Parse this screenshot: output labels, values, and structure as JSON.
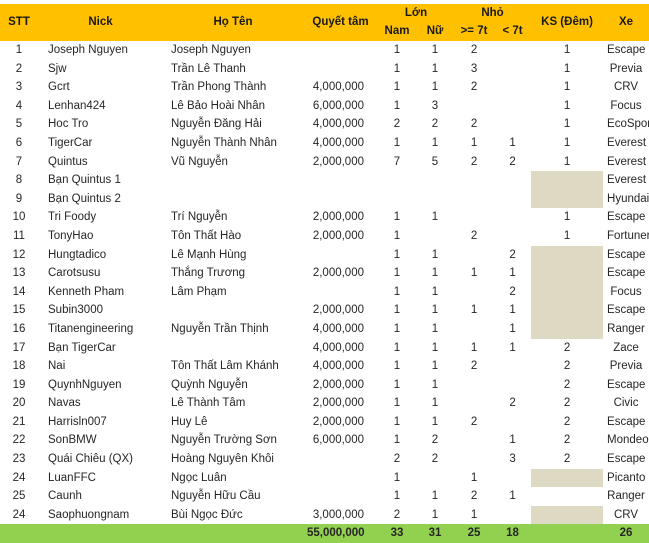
{
  "table": {
    "headers": {
      "stt": "STT",
      "nick": "Nick",
      "hoten": "Họ Tên",
      "quyettam": "Quyết tâm",
      "lon": "Lớn",
      "nho": "Nhỏ",
      "nam": "Nam",
      "nu": "Nữ",
      "ge7t": ">= 7t",
      "lt7t": "< 7t",
      "ks": "KS (Đêm)",
      "xe": "Xe"
    },
    "colors": {
      "header_bg": "#FFC000",
      "total_bg": "#92D050",
      "shaded_cell_bg": "#DDD9C3",
      "text": "#262626"
    },
    "rows": [
      {
        "stt": "1",
        "nick": "Joseph Nguyen",
        "hoten": "Joseph Nguyen",
        "quyettam": "",
        "nam": "1",
        "nu": "1",
        "ge7t": "2",
        "lt7t": "",
        "ks": "1",
        "ks_shaded": false,
        "xe": "Escape"
      },
      {
        "stt": "2",
        "nick": "Sjw",
        "hoten": "Trần Lê Thanh",
        "quyettam": "",
        "nam": "1",
        "nu": "1",
        "ge7t": "3",
        "lt7t": "",
        "ks": "1",
        "ks_shaded": false,
        "xe": "Previa"
      },
      {
        "stt": "3",
        "nick": "Gcrt",
        "hoten": "Trần Phong Thành",
        "quyettam": "4,000,000",
        "nam": "1",
        "nu": "1",
        "ge7t": "2",
        "lt7t": "",
        "ks": "1",
        "ks_shaded": false,
        "xe": "CRV"
      },
      {
        "stt": "4",
        "nick": "Lenhan424",
        "hoten": "Lê Bảo Hoài Nhân",
        "quyettam": "6,000,000",
        "nam": "1",
        "nu": "3",
        "ge7t": "",
        "lt7t": "",
        "ks": "1",
        "ks_shaded": false,
        "xe": "Focus"
      },
      {
        "stt": "5",
        "nick": "Hoc Tro",
        "hoten": "Nguyễn Đăng Hải",
        "quyettam": "4,000,000",
        "nam": "2",
        "nu": "2",
        "ge7t": "2",
        "lt7t": "",
        "ks": "1",
        "ks_shaded": false,
        "xe": "EcoSport"
      },
      {
        "stt": "6",
        "nick": "TigerCar",
        "hoten": "Nguyễn Thành Nhân",
        "quyettam": "4,000,000",
        "nam": "1",
        "nu": "1",
        "ge7t": "1",
        "lt7t": "1",
        "ks": "1",
        "ks_shaded": false,
        "xe": "Everest"
      },
      {
        "stt": "7",
        "nick": "Quintus",
        "hoten": "Vũ Nguyễn",
        "quyettam": "2,000,000",
        "nam": "7",
        "nu": "5",
        "ge7t": "2",
        "lt7t": "2",
        "ks": "1",
        "ks_shaded": false,
        "xe": "Everest"
      },
      {
        "stt": "8",
        "nick": "Bạn Quintus 1",
        "hoten": "",
        "quyettam": "",
        "nam": "",
        "nu": "",
        "ge7t": "",
        "lt7t": "",
        "ks": "",
        "ks_shaded": true,
        "xe": "Everest"
      },
      {
        "stt": "9",
        "nick": "Bạn Quintus 2",
        "hoten": "",
        "quyettam": "",
        "nam": "",
        "nu": "",
        "ge7t": "",
        "lt7t": "",
        "ks": "",
        "ks_shaded": true,
        "xe": "Hyundai"
      },
      {
        "stt": "10",
        "nick": "Tri Foody",
        "hoten": "Trí Nguyễn",
        "quyettam": "2,000,000",
        "nam": "1",
        "nu": "1",
        "ge7t": "",
        "lt7t": "",
        "ks": "1",
        "ks_shaded": false,
        "xe": "Escape"
      },
      {
        "stt": "11",
        "nick": "TonyHao",
        "hoten": "Tôn Thất Hào",
        "quyettam": "2,000,000",
        "nam": "1",
        "nu": "",
        "ge7t": "2",
        "lt7t": "",
        "ks": "1",
        "ks_shaded": false,
        "xe": "Fortuner"
      },
      {
        "stt": "12",
        "nick": "Hungtadico",
        "hoten": "Lê Mạnh Hùng",
        "quyettam": "",
        "nam": "1",
        "nu": "1",
        "ge7t": "",
        "lt7t": "2",
        "ks": "",
        "ks_shaded": true,
        "xe": "Escape"
      },
      {
        "stt": "13",
        "nick": "Carotsusu",
        "hoten": "Thắng Trương",
        "quyettam": "2,000,000",
        "nam": "1",
        "nu": "1",
        "ge7t": "1",
        "lt7t": "1",
        "ks": "",
        "ks_shaded": true,
        "xe": "Escape"
      },
      {
        "stt": "14",
        "nick": "Kenneth Pham",
        "hoten": "Lâm Phạm",
        "quyettam": "",
        "nam": "1",
        "nu": "1",
        "ge7t": "",
        "lt7t": "2",
        "ks": "",
        "ks_shaded": true,
        "xe": "Focus"
      },
      {
        "stt": "15",
        "nick": "Subin3000",
        "hoten": "",
        "quyettam": "2,000,000",
        "nam": "1",
        "nu": "1",
        "ge7t": "1",
        "lt7t": "1",
        "ks": "",
        "ks_shaded": true,
        "xe": "Escape"
      },
      {
        "stt": "16",
        "nick": "Titanengineering",
        "hoten": "Nguyễn Trần Thịnh",
        "quyettam": "4,000,000",
        "nam": "1",
        "nu": "1",
        "ge7t": "",
        "lt7t": "1",
        "ks": "",
        "ks_shaded": true,
        "xe": "Ranger"
      },
      {
        "stt": "17",
        "nick": "Bạn TigerCar",
        "hoten": "",
        "quyettam": "4,000,000",
        "nam": "1",
        "nu": "1",
        "ge7t": "1",
        "lt7t": "1",
        "ks": "2",
        "ks_shaded": false,
        "xe": "Zace"
      },
      {
        "stt": "18",
        "nick": "Nai",
        "hoten": "Tôn Thất Lâm Khánh",
        "quyettam": "4,000,000",
        "nam": "1",
        "nu": "1",
        "ge7t": "2",
        "lt7t": "",
        "ks": "2",
        "ks_shaded": false,
        "xe": "Previa"
      },
      {
        "stt": "19",
        "nick": "QuynhNguyen",
        "hoten": "Quỳnh Nguyễn",
        "quyettam": "2,000,000",
        "nam": "1",
        "nu": "1",
        "ge7t": "",
        "lt7t": "",
        "ks": "2",
        "ks_shaded": false,
        "xe": "Escape"
      },
      {
        "stt": "20",
        "nick": "Navas",
        "hoten": "Lê Thành Tâm",
        "quyettam": "2,000,000",
        "nam": "1",
        "nu": "1",
        "ge7t": "",
        "lt7t": "2",
        "ks": "2",
        "ks_shaded": false,
        "xe": "Civic"
      },
      {
        "stt": "21",
        "nick": "Harrisln007",
        "hoten": "Huy Lê",
        "quyettam": "2,000,000",
        "nam": "1",
        "nu": "1",
        "ge7t": "2",
        "lt7t": "",
        "ks": "2",
        "ks_shaded": false,
        "xe": "Escape"
      },
      {
        "stt": "22",
        "nick": "SonBMW",
        "hoten": "Nguyễn Trường Sơn",
        "quyettam": "6,000,000",
        "nam": "1",
        "nu": "2",
        "ge7t": "",
        "lt7t": "1",
        "ks": "2",
        "ks_shaded": false,
        "xe": "Mondeo"
      },
      {
        "stt": "23",
        "nick": "Quái Chiêu (QX)",
        "hoten": "Hoàng Nguyên Khôi",
        "quyettam": "",
        "nam": "2",
        "nu": "2",
        "ge7t": "",
        "lt7t": "3",
        "ks": "2",
        "ks_shaded": false,
        "xe": "Escape"
      },
      {
        "stt": "24",
        "nick": "LuanFFC",
        "hoten": "Ngọc Luân",
        "quyettam": "",
        "nam": "1",
        "nu": "",
        "ge7t": "1",
        "lt7t": "",
        "ks": "",
        "ks_shaded": true,
        "xe": "Picanto"
      },
      {
        "stt": "25",
        "nick": "Caunh",
        "hoten": "Nguyễn Hữu Cầu",
        "quyettam": "",
        "nam": "1",
        "nu": "1",
        "ge7t": "2",
        "lt7t": "1",
        "ks": "",
        "ks_shaded": false,
        "xe": "Ranger"
      },
      {
        "stt": "24",
        "nick": "Saophuongnam",
        "hoten": "Bùi Ngọc Đức",
        "quyettam": "3,000,000",
        "nam": "2",
        "nu": "1",
        "ge7t": "1",
        "lt7t": "",
        "ks": "",
        "ks_shaded": true,
        "xe": "CRV"
      }
    ],
    "total": {
      "stt": "",
      "nick": "",
      "hoten": "",
      "quyettam": "55,000,000",
      "nam": "33",
      "nu": "31",
      "ge7t": "25",
      "lt7t": "18",
      "ks": "",
      "xe": "26"
    }
  }
}
